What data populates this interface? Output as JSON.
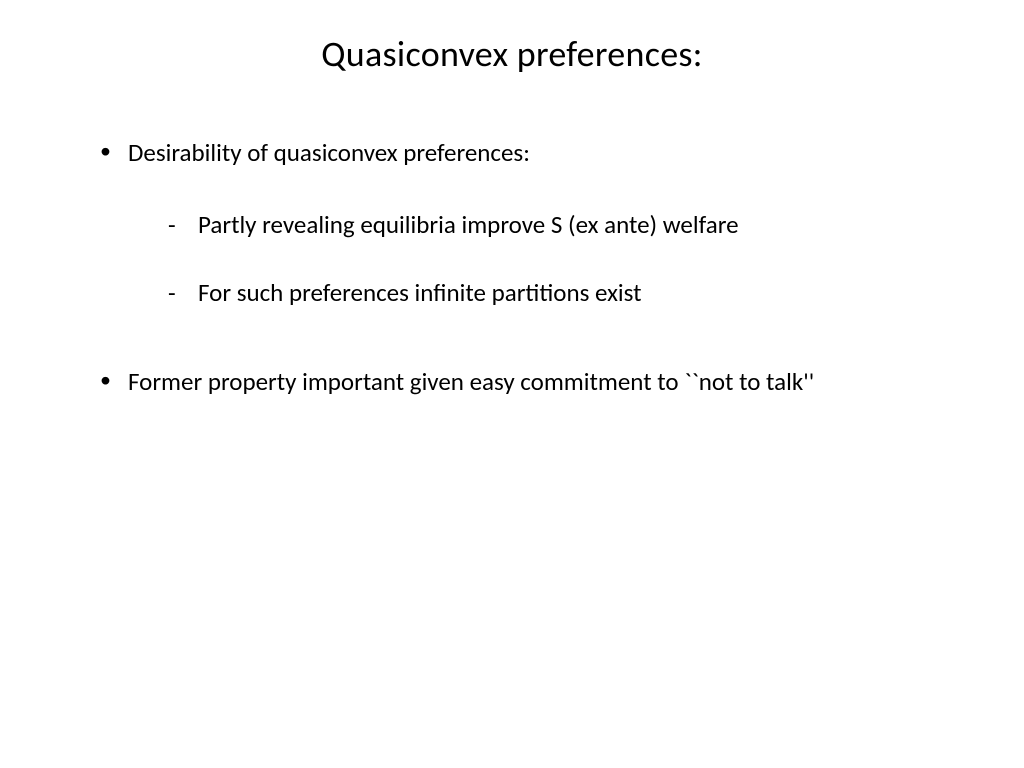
{
  "slide": {
    "title": "Quasiconvex preferences:",
    "bullets": [
      {
        "text": "Desirability of quasiconvex preferences:",
        "subs": [
          "Partly revealing  equilibria improve S (ex ante) welfare",
          "For such preferences infinite partitions exist"
        ]
      },
      {
        "text": "Former property important given easy commitment to ``not to talk''"
      }
    ]
  }
}
